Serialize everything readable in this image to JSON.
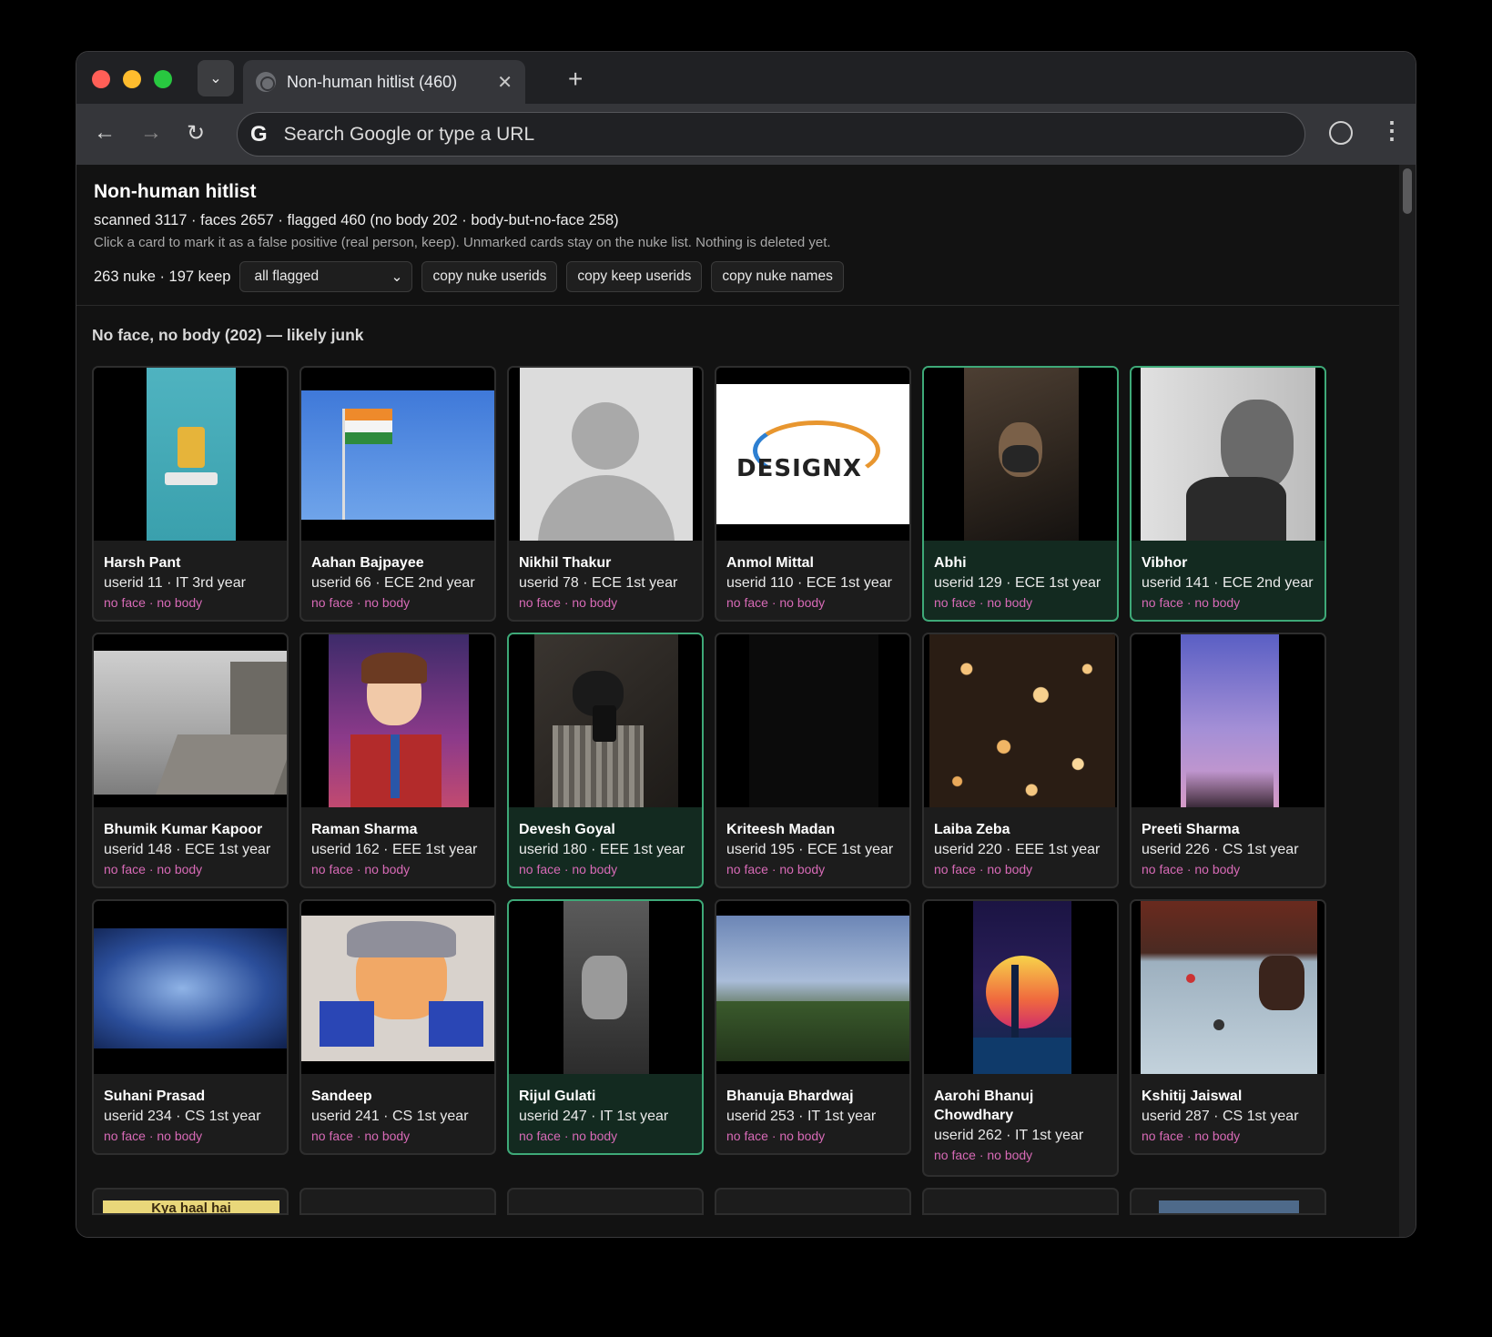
{
  "browser": {
    "tab_title": "Non-human hitlist (460)",
    "tab_close": "✕",
    "new_tab": "+",
    "search_dropdown": "⌄",
    "omnibox_placeholder": "Search Google or type a URL",
    "google_logo": "G",
    "back": "←",
    "forward": "→",
    "reload": "↻",
    "menu": "⋮",
    "lights": {
      "close": "#ff5f57",
      "minimize": "#febc2e",
      "maximize": "#28c840"
    }
  },
  "header": {
    "title": "Non-human hitlist",
    "stats": "scanned 3117 · faces 2657 · flagged 460 (no body 202 · body-but-no-face 258)",
    "hint": "Click a card to mark it as a false positive (real person, keep). Unmarked cards stay on the nuke list. Nothing is deleted yet.",
    "counts": "263 nuke · 197 keep",
    "filter_value": "all flagged",
    "filter_chevron": "⌄",
    "buttons": {
      "copy_nuke_userids": "copy nuke userids",
      "copy_keep_userids": "copy keep userids",
      "copy_nuke_names": "copy nuke names"
    }
  },
  "section": {
    "title": "No face, no body (202) — likely junk"
  },
  "colors": {
    "keep_border": "#3ea978",
    "keep_bg": "#132a20",
    "flag_text": "#d76ab6"
  },
  "cards": [
    {
      "name": "Harsh Pant",
      "meta": "userid 11 · IT 3rd year",
      "flags": "no face · no body",
      "keep": false
    },
    {
      "name": "Aahan Bajpayee",
      "meta": "userid 66 · ECE 2nd year",
      "flags": "no face · no body",
      "keep": false
    },
    {
      "name": "Nikhil Thakur",
      "meta": "userid 78 · ECE 1st year",
      "flags": "no face · no body",
      "keep": false
    },
    {
      "name": "Anmol Mittal",
      "meta": "userid 110 · ECE 1st year",
      "flags": "no face · no body",
      "keep": false
    },
    {
      "name": "Abhi",
      "meta": "userid 129 · ECE 1st year",
      "flags": "no face · no body",
      "keep": true
    },
    {
      "name": "Vibhor",
      "meta": "userid 141 · ECE 2nd year",
      "flags": "no face · no body",
      "keep": true
    },
    {
      "name": "Bhumik Kumar Kapoor",
      "meta": "userid 148 · ECE 1st year",
      "flags": "no face · no body",
      "keep": false
    },
    {
      "name": "Raman Sharma",
      "meta": "userid 162 · EEE 1st year",
      "flags": "no face · no body",
      "keep": false
    },
    {
      "name": "Devesh Goyal",
      "meta": "userid 180 · EEE 1st year",
      "flags": "no face · no body",
      "keep": true
    },
    {
      "name": "Kriteesh Madan",
      "meta": "userid 195 · ECE 1st year",
      "flags": "no face · no body",
      "keep": false
    },
    {
      "name": "Laiba Zeba",
      "meta": "userid 220 · EEE 1st year",
      "flags": "no face · no body",
      "keep": false
    },
    {
      "name": "Preeti Sharma",
      "meta": "userid 226 · CS 1st year",
      "flags": "no face · no body",
      "keep": false
    },
    {
      "name": "Suhani Prasad",
      "meta": "userid 234 · CS 1st year",
      "flags": "no face · no body",
      "keep": false
    },
    {
      "name": "Sandeep",
      "meta": "userid 241 · CS 1st year",
      "flags": "no face · no body",
      "keep": false
    },
    {
      "name": "Rijul Gulati",
      "meta": "userid 247 · IT 1st year",
      "flags": "no face · no body",
      "keep": true
    },
    {
      "name": "Bhanuja Bhardwaj",
      "meta": "userid 253 · IT 1st year",
      "flags": "no face · no body",
      "keep": false
    },
    {
      "name": "Aarohi Bhanuj Chowdhary",
      "meta": "userid 262 · IT 1st year",
      "flags": "no face · no body",
      "keep": false
    },
    {
      "name": "Kshitij Jaiswal",
      "meta": "userid 287 · CS 1st year",
      "flags": "no face · no body",
      "keep": false
    }
  ],
  "partial_card_text": "Kya haal hai"
}
